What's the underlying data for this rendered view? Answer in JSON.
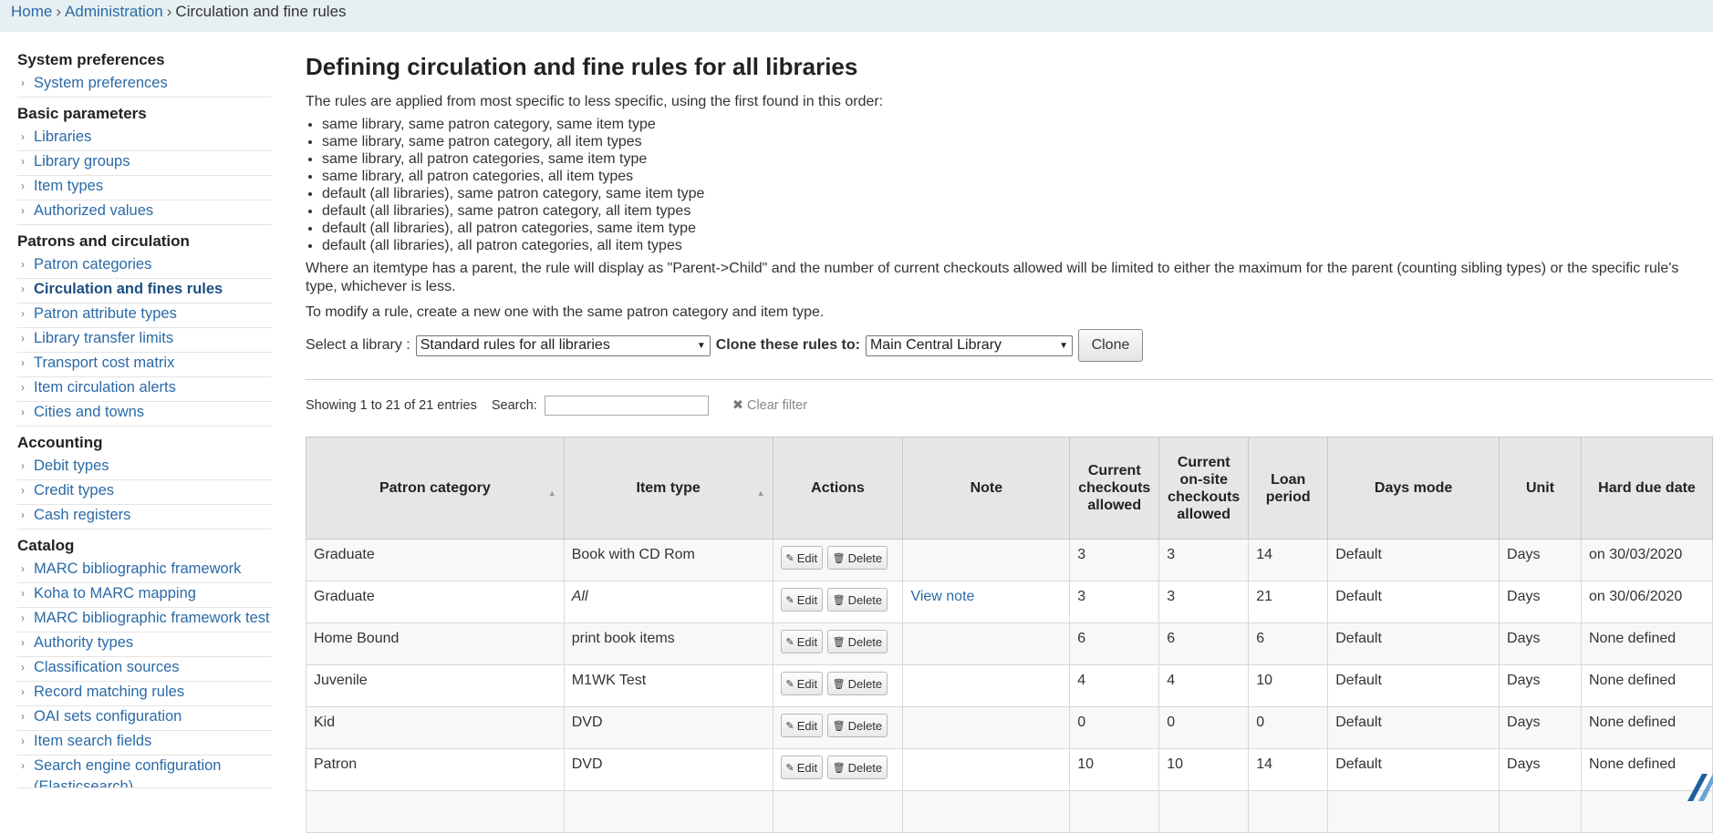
{
  "breadcrumb": {
    "home": "Home",
    "admin": "Administration",
    "current": "Circulation and fine rules"
  },
  "sidebar": {
    "sections": [
      {
        "heading": "System preferences",
        "items": [
          {
            "label": "System preferences",
            "active": false
          }
        ]
      },
      {
        "heading": "Basic parameters",
        "items": [
          {
            "label": "Libraries",
            "active": false
          },
          {
            "label": "Library groups",
            "active": false
          },
          {
            "label": "Item types",
            "active": false
          },
          {
            "label": "Authorized values",
            "active": false
          }
        ]
      },
      {
        "heading": "Patrons and circulation",
        "items": [
          {
            "label": "Patron categories",
            "active": false
          },
          {
            "label": "Circulation and fines rules",
            "active": true
          },
          {
            "label": "Patron attribute types",
            "active": false
          },
          {
            "label": "Library transfer limits",
            "active": false
          },
          {
            "label": "Transport cost matrix",
            "active": false
          },
          {
            "label": "Item circulation alerts",
            "active": false
          },
          {
            "label": "Cities and towns",
            "active": false
          }
        ]
      },
      {
        "heading": "Accounting",
        "items": [
          {
            "label": "Debit types",
            "active": false
          },
          {
            "label": "Credit types",
            "active": false
          },
          {
            "label": "Cash registers",
            "active": false
          }
        ]
      },
      {
        "heading": "Catalog",
        "items": [
          {
            "label": "MARC bibliographic framework",
            "active": false
          },
          {
            "label": "Koha to MARC mapping",
            "active": false
          },
          {
            "label": "MARC bibliographic framework test",
            "active": false
          },
          {
            "label": "Authority types",
            "active": false
          },
          {
            "label": "Classification sources",
            "active": false
          },
          {
            "label": "Record matching rules",
            "active": false
          },
          {
            "label": "OAI sets configuration",
            "active": false
          },
          {
            "label": "Item search fields",
            "active": false
          },
          {
            "label": "Search engine configuration (Elasticsearch)",
            "active": false
          }
        ]
      }
    ]
  },
  "main": {
    "title": "Defining circulation and fine rules for all libraries",
    "intro": "The rules are applied from most specific to less specific, using the first found in this order:",
    "order": [
      "same library, same patron category, same item type",
      "same library, same patron category, all item types",
      "same library, all patron categories, same item type",
      "same library, all patron categories, all item types",
      "default (all libraries), same patron category, same item type",
      "default (all libraries), same patron category, all item types",
      "default (all libraries), all patron categories, same item type",
      "default (all libraries), all patron categories, all item types"
    ],
    "parent_note": "Where an itemtype has a parent, the rule will display as \"Parent->Child\" and the number of current checkouts allowed will be limited to either the maximum for the parent (counting sibling types) or the specific rule's type, whichever is less.",
    "modify_note": "To modify a rule, create a new one with the same patron category and item type.",
    "select_library_label": "Select a library :",
    "select_library_value": "Standard rules for all libraries",
    "clone_label": "Clone these rules to:",
    "clone_value": "Main Central Library",
    "clone_button": "Clone",
    "showing": "Showing 1 to 21 of 21 entries",
    "search_label": "Search:",
    "search_value": "",
    "clear_filter": "Clear filter"
  },
  "table": {
    "headers": {
      "patron_category": "Patron category",
      "item_type": "Item type",
      "actions": "Actions",
      "note": "Note",
      "checkouts_1": "Current",
      "checkouts_2": "checkouts",
      "checkouts_3": "allowed",
      "onsite_1": "Current",
      "onsite_2": "on-site",
      "onsite_3": "checkouts",
      "onsite_4": "allowed",
      "loan_1": "Loan",
      "loan_2": "period",
      "days_mode": "Days mode",
      "unit": "Unit",
      "hard_due": "Hard due date"
    },
    "edit_label": "Edit",
    "delete_label": "Delete",
    "rows": [
      {
        "patron": "Graduate",
        "item": "Book with CD Rom",
        "item_italic": false,
        "note": "",
        "checkouts": "3",
        "onsite": "3",
        "loan": "14",
        "days_mode": "Default",
        "unit": "Days",
        "hard_due": "on 30/03/2020"
      },
      {
        "patron": "Graduate",
        "item": "All",
        "item_italic": true,
        "note": "View note",
        "checkouts": "3",
        "onsite": "3",
        "loan": "21",
        "days_mode": "Default",
        "unit": "Days",
        "hard_due": "on 30/06/2020"
      },
      {
        "patron": "Home Bound",
        "item": "print book items",
        "item_italic": false,
        "note": "",
        "checkouts": "6",
        "onsite": "6",
        "loan": "6",
        "days_mode": "Default",
        "unit": "Days",
        "hard_due": "None defined"
      },
      {
        "patron": "Juvenile",
        "item": "M1WK Test",
        "item_italic": false,
        "note": "",
        "checkouts": "4",
        "onsite": "4",
        "loan": "10",
        "days_mode": "Default",
        "unit": "Days",
        "hard_due": "None defined"
      },
      {
        "patron": "Kid",
        "item": "DVD",
        "item_italic": false,
        "note": "",
        "checkouts": "0",
        "onsite": "0",
        "loan": "0",
        "days_mode": "Default",
        "unit": "Days",
        "hard_due": "None defined"
      },
      {
        "patron": "Patron",
        "item": "DVD",
        "item_italic": false,
        "note": "",
        "checkouts": "10",
        "onsite": "10",
        "loan": "14",
        "days_mode": "Default",
        "unit": "Days",
        "hard_due": "None defined"
      },
      {
        "patron": "",
        "item": "",
        "item_italic": false,
        "note": "",
        "checkouts": "",
        "onsite": "",
        "loan": "",
        "days_mode": "",
        "unit": "",
        "hard_due": ""
      }
    ]
  }
}
